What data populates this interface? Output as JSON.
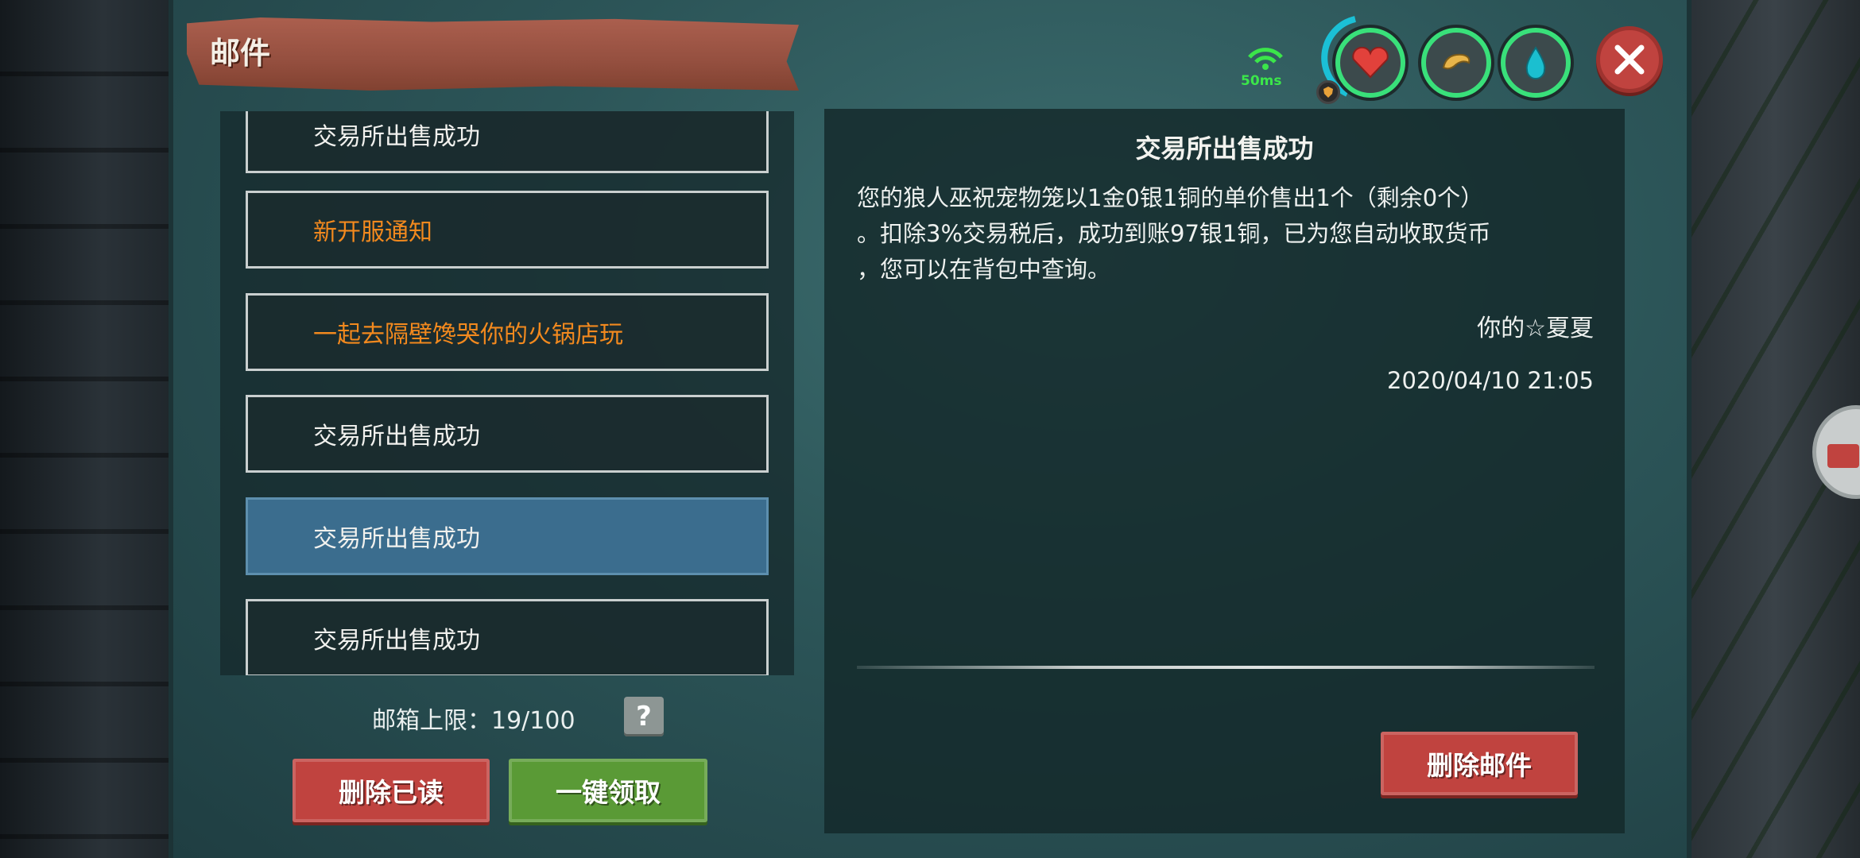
{
  "window": {
    "title": "邮件"
  },
  "hud": {
    "ping": "50ms",
    "icons": [
      "signal-icon",
      "heart-icon",
      "food-icon",
      "water-icon"
    ],
    "close_icon": "close-icon"
  },
  "mail_list": {
    "items": [
      {
        "subject": "交易所出售成功",
        "state": "read"
      },
      {
        "subject": "新开服通知",
        "state": "unread"
      },
      {
        "subject": "一起去隔壁馋哭你的火锅店玩",
        "state": "unread"
      },
      {
        "subject": "交易所出售成功",
        "state": "read"
      },
      {
        "subject": "交易所出售成功",
        "state": "selected"
      },
      {
        "subject": "交易所出售成功",
        "state": "read"
      }
    ],
    "quota_label": "邮箱上限：19/100",
    "help_label": "?",
    "delete_read_label": "删除已读",
    "claim_all_label": "一键领取"
  },
  "detail": {
    "title": "交易所出售成功",
    "body_line1": "您的狼人巫祝宠物笼以1金0银1铜的单价售出1个（剩余0个）",
    "body_line2": "。扣除3%交易税后，成功到账97银1铜，已为您自动收取货币",
    "body_line3": "，您可以在背包中查询。",
    "signature": "你的☆夏夏",
    "date": "2020/04/10 21:05",
    "delete_label": "删除邮件"
  },
  "colors": {
    "panel": "#2c5558",
    "unread_text": "#f2891e",
    "selected_row": "#3b6d8e",
    "danger_button": "#c0433f",
    "success_button": "#5a9a36",
    "hud_ring": "#39e07a"
  }
}
